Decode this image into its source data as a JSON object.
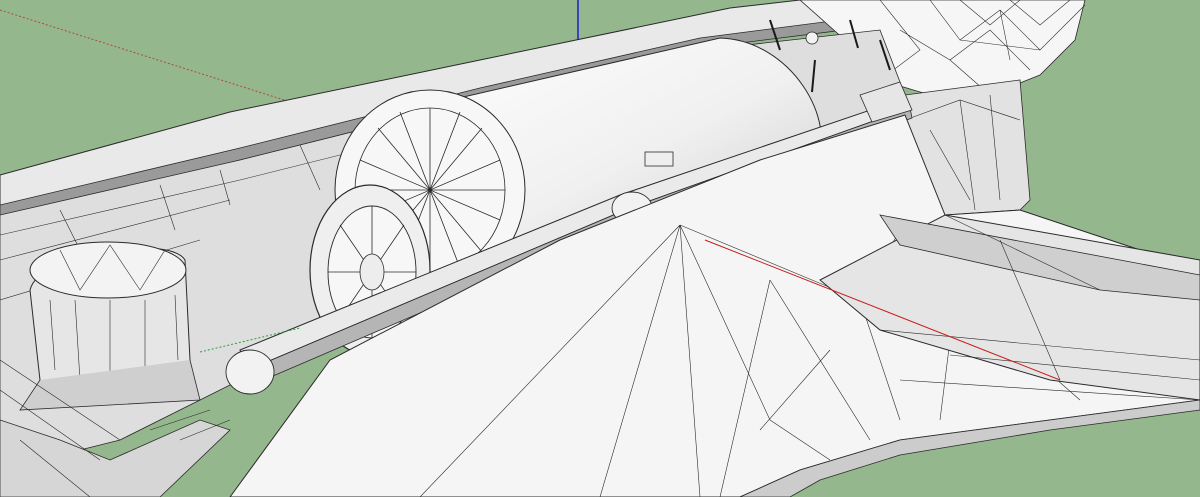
{
  "viewport": {
    "background_color": "#95b78d",
    "model_fill": "#f4f4f4",
    "model_shade": "#d8d8d8",
    "edge_color": "#2a2a2a",
    "axis_colors": {
      "red": "#c81e1e",
      "green": "#2e9e2e",
      "blue": "#1e1ec8"
    }
  }
}
